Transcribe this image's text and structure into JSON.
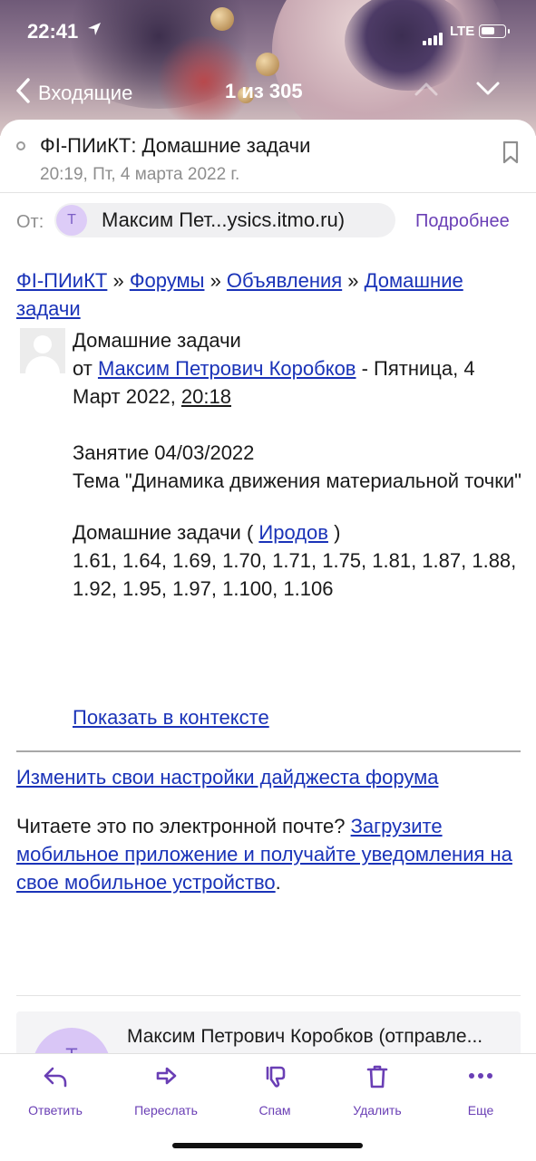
{
  "status_bar": {
    "time": "22:41",
    "network": "LTE"
  },
  "nav": {
    "back_label": "Входящие",
    "counter": "1 из 305"
  },
  "email": {
    "subject": "ФI-ПИиКТ: Домашние задачи",
    "date": "20:19, Пт, 4 марта 2022 г.",
    "from_label": "От:",
    "sender_initial": "Т",
    "sender": "Максим Пет...ysics.itmo.ru)",
    "details_label": "Подробнее"
  },
  "body": {
    "breadcrumb": {
      "crumb1": "ФI-ПИиКТ",
      "sep": " » ",
      "crumb2": "Форумы",
      "crumb3": "Объявления",
      "crumb4": "Домашние задачи"
    },
    "post_title": "Домашние задачи",
    "by_prefix": "от ",
    "author": "Максим Петрович Коробков",
    "date_prefix": " - Пятница, 4 Март 2022, ",
    "time": "20:18",
    "lesson": "Занятие 04/03/2022",
    "topic": "Тема \"Динамика движения материальной точки\"",
    "hw_prefix": "Домашние задачи ( ",
    "hw_book": "Иродов",
    "hw_suffix": " )",
    "hw_numbers": "1.61, 1.64, 1.69, 1.70, 1.71, 1.75, 1.81, 1.87, 1.88, 1.92, 1.95, 1.97, 1.100, 1.106",
    "show_context": "Показать в контексте",
    "digest_settings": "Изменить свои настройки дайджеста форума",
    "mobile_prefix": "Читаете это по электронной почте? ",
    "mobile_link": "Загрузите мобильное приложение и получайте уведомления на свое мобильное устройство",
    "mobile_suffix": "."
  },
  "next_message": {
    "initial": "Т",
    "sender": "Максим Петрович Коробков (отправле..."
  },
  "toolbar": {
    "reply": "Ответить",
    "forward": "Переслать",
    "spam": "Спам",
    "delete": "Удалить",
    "more": "Еще"
  },
  "colors": {
    "accent": "#6a3fb5",
    "link": "#1a33b8",
    "avatar_bg": "#ddccf7"
  }
}
